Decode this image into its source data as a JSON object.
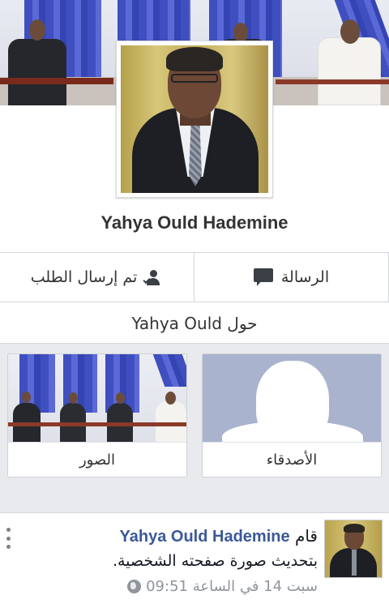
{
  "profile": {
    "name": "Yahya Ould Hademine"
  },
  "actions": {
    "friend_request_label": "تم إرسال الطلب",
    "message_label": "الرسالة"
  },
  "about": {
    "label": "حول Yahya Ould"
  },
  "tiles": {
    "friends_label": "الأصدقاء",
    "photos_label": "الصور"
  },
  "story": {
    "prefix": "قام",
    "author": "Yahya Ould Hademine",
    "text": "بتحديث صورة صفحته الشخصية.",
    "timestamp": "سبت 14 في الساعة 09:51"
  },
  "colors": {
    "link_blue": "#3b5998",
    "curtain_blue": "#3f4fc0",
    "muted_gray": "#90949c"
  }
}
